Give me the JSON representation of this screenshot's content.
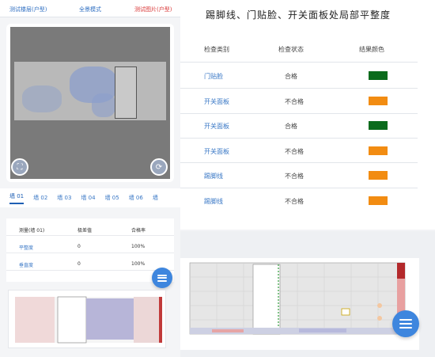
{
  "topbar": {
    "item1": "测试楼层(户型)",
    "item2": "全景模式",
    "item3": "测试图片(户型)"
  },
  "viewer": {
    "left_button_icon": "fullscreen-icon",
    "right_button_icon": "rotate-icon"
  },
  "tabs": [
    "墙 01",
    "墙 02",
    "墙 03",
    "墙 04",
    "墙 05",
    "墙 06",
    "墙"
  ],
  "wall_table": {
    "headers": [
      "测量(墙 01)",
      "极差值",
      "合格率"
    ],
    "rows": [
      {
        "name": "平整度",
        "value": "0",
        "rate": "100%"
      },
      {
        "name": "垂直度",
        "value": "0",
        "rate": "100%"
      }
    ]
  },
  "inspection": {
    "title": "踢脚线、门贴脸、开关面板处局部平整度",
    "headers": [
      "检查类别",
      "检查状态",
      "结果颜色"
    ],
    "rows": [
      {
        "category": "门贴脸",
        "status": "合格",
        "color": "#0b6b1c"
      },
      {
        "category": "开关面板",
        "status": "不合格",
        "color": "#f28c12"
      },
      {
        "category": "开关面板",
        "status": "合格",
        "color": "#0b6b1c"
      },
      {
        "category": "开关面板",
        "status": "不合格",
        "color": "#f28c12"
      },
      {
        "category": "踢脚线",
        "status": "不合格",
        "color": "#f28c12"
      },
      {
        "category": "踢脚线",
        "status": "不合格",
        "color": "#f28c12"
      }
    ]
  },
  "colors": {
    "accent": "#3e86de",
    "pass": "#0b6b1c",
    "fail": "#f28c12",
    "link": "#3a78c6"
  },
  "menu_icon": "menu-icon"
}
